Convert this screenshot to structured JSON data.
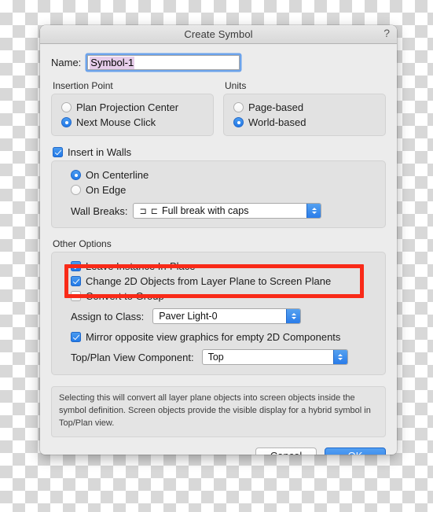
{
  "window": {
    "title": "Create Symbol",
    "help_icon": "?"
  },
  "name_field": {
    "label": "Name:",
    "value": "Symbol-1",
    "selected": true
  },
  "insertion_point": {
    "title": "Insertion Point",
    "options": [
      {
        "label": "Plan Projection Center",
        "selected": false
      },
      {
        "label": "Next Mouse Click",
        "selected": true
      }
    ]
  },
  "units": {
    "title": "Units",
    "options": [
      {
        "label": "Page-based",
        "selected": false
      },
      {
        "label": "World-based",
        "selected": true
      }
    ]
  },
  "insert_in_walls": {
    "label": "Insert in Walls",
    "checked": true,
    "options": [
      {
        "label": "On Centerline",
        "selected": true
      },
      {
        "label": "On Edge",
        "selected": false
      }
    ],
    "wall_breaks": {
      "label": "Wall Breaks:",
      "glyph": "⊐ ⊏",
      "value": "Full break with caps"
    }
  },
  "other_options": {
    "title": "Other Options",
    "checkboxes": [
      {
        "label": "Leave Instance In-Place",
        "checked": true
      },
      {
        "label": "Change 2D Objects from Layer Plane to Screen Plane",
        "checked": true
      },
      {
        "label": "Convert to Group",
        "checked": false
      }
    ],
    "assign_to_class": {
      "label": "Assign to Class:",
      "value": "Paver Light-0"
    },
    "mirror": {
      "label": "Mirror opposite view graphics for empty 2D Components",
      "checked": true
    },
    "top_plan_view": {
      "label": "Top/Plan View Component:",
      "value": "Top"
    }
  },
  "note": {
    "text": "Selecting this will convert all layer plane objects into screen objects inside the symbol definition.  Screen objects provide the visible display for a hybrid symbol in Top/Plan view."
  },
  "buttons": {
    "cancel": "Cancel",
    "ok": "OK"
  },
  "annotation": {
    "color": "#f92a18",
    "targets": "Change 2D Objects from Layer Plane to Screen Plane"
  }
}
